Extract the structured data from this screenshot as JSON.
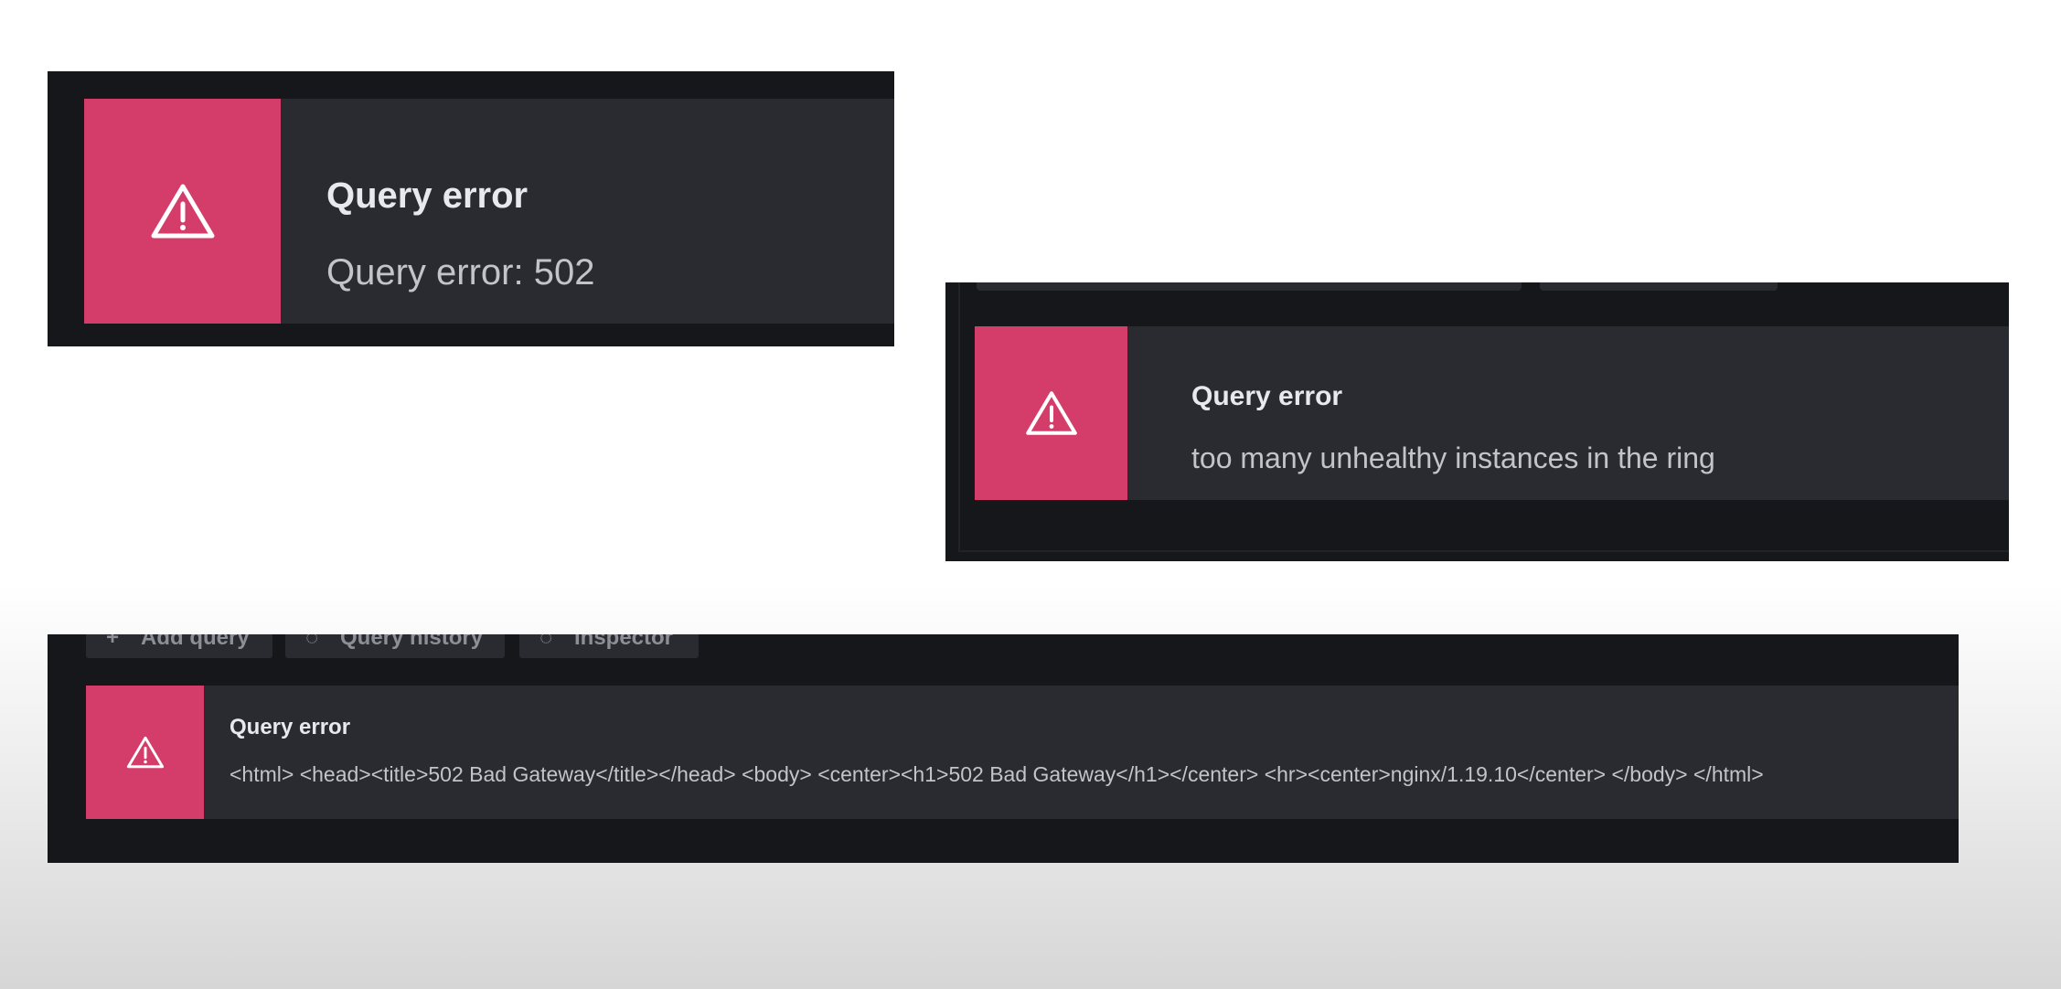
{
  "panels": [
    {
      "alert_title": "Query error",
      "alert_message": "Query error: 502",
      "icon": "warning-triangle-icon"
    },
    {
      "alert_title": "Query error",
      "alert_message": "too many unhealthy instances in the ring",
      "icon": "warning-triangle-icon"
    },
    {
      "toolbar": {
        "add_query_label": "Add query",
        "query_history_label": "Query history",
        "inspector_label": "Inspector"
      },
      "alert_title": "Query error",
      "alert_message": "<html> <head><title>502 Bad Gateway</title></head> <body> <center><h1>502 Bad Gateway</h1></center> <hr><center>nginx/1.19.10</center> </body> </html>",
      "icon": "warning-triangle-icon"
    }
  ],
  "colors": {
    "alert_accent": "#d43d6a",
    "panel_bg": "#16171b",
    "alert_bg": "#2a2b31",
    "title_text": "#e8e9ec",
    "message_text": "#c2c4c9"
  }
}
